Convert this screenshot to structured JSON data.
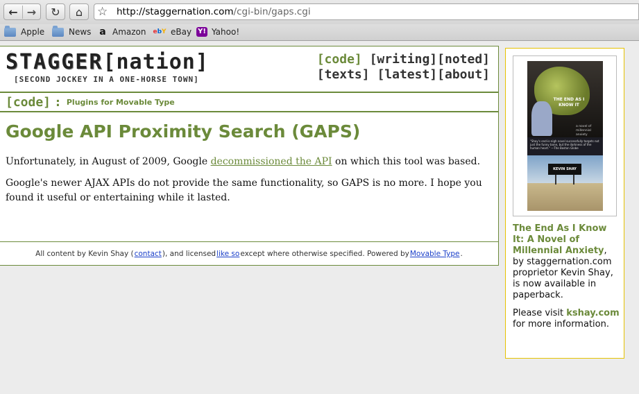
{
  "browser": {
    "url_host": "http://staggernation.com",
    "url_path": "/cgi-bin/gaps.cgi",
    "bookmarks": [
      {
        "label": "Apple",
        "icon": "folder-icon"
      },
      {
        "label": "News",
        "icon": "folder-icon"
      },
      {
        "label": "Amazon",
        "icon": "amazon-icon"
      },
      {
        "label": "eBay",
        "icon": "ebay-icon"
      },
      {
        "label": "Yahoo!",
        "icon": "yahoo-icon"
      }
    ]
  },
  "site": {
    "logo_stagger": "STAGGER",
    "logo_nation": "[nation]",
    "tagline": "[SECOND JOCKEY IN A ONE-HORSE TOWN]",
    "nav": [
      {
        "label": "[code]",
        "active": true
      },
      {
        "label": "[writing]",
        "active": false
      },
      {
        "label": "[noted]",
        "active": false
      },
      {
        "label": "[texts]",
        "active": false
      },
      {
        "label": "[latest]",
        "active": false
      },
      {
        "label": "[about]",
        "active": false
      }
    ]
  },
  "crumb": {
    "section": "[code]",
    "separator": ":",
    "subsection": "Plugins for Movable Type"
  },
  "article": {
    "title": "Google API Proximity Search (GAPS)",
    "p1_before": "Unfortunately, in August of 2009, Google ",
    "p1_link": "decommissioned the API",
    "p1_after": " on which this tool was based.",
    "p2": "Google's newer AJAX APIs do not provide the same functionality, so GAPS is no more. I hope you found it useful or entertaining while it lasted."
  },
  "footer": {
    "t1": "All content by Kevin Shay (",
    "contact": "contact",
    "t2": "), and licensed ",
    "license": "like so",
    "t3": " except where otherwise specified. Powered by ",
    "powered": "Movable Type",
    "t4": "."
  },
  "sidebar": {
    "cover_title": "THE END AS I KNOW IT",
    "cover_subtitle": "a novel of millennial anxiety",
    "cover_quote": "\"Shay's end-is-nigh novel successfully targets not just the funny bone, but the darkness of the human heart.\" —The Boston Globe",
    "cover_author": "KEVIN SHAY",
    "book_link": "The End As I Know It: A Novel of Millennial Anxiety",
    "blurb": ", by staggernation.com proprietor Kevin Shay, is now available in paperback.",
    "visit_before": "Please visit ",
    "site_link": "kshay.com",
    "visit_after": " for more information."
  },
  "colors": {
    "accent_green": "#6b8a3a",
    "ad_border": "#e6c200",
    "link_blue": "#1a3fc9"
  }
}
